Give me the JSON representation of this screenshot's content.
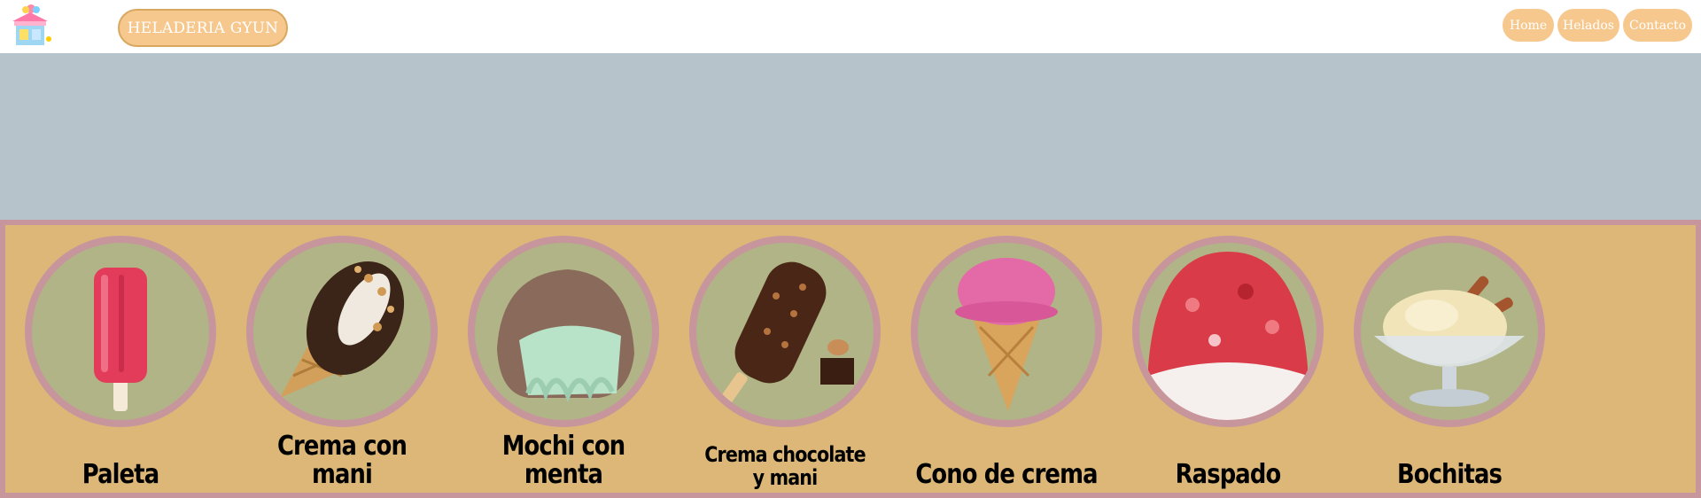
{
  "header": {
    "brand": "HELADERIA GYUN",
    "nav": [
      {
        "label": "Home"
      },
      {
        "label": "Helados"
      },
      {
        "label": "Contacto"
      }
    ]
  },
  "colors": {
    "pill": "#f6c88e",
    "hero": "#b6c3ca",
    "gallery_bg": "#dcb778",
    "gallery_border": "#c7969c",
    "circle_bg": "#b0b486"
  },
  "products": [
    {
      "name": "Paleta",
      "icon": "popsicle-icon"
    },
    {
      "name": "Crema con mani",
      "icon": "peanut-cone-icon"
    },
    {
      "name": "Mochi con menta",
      "icon": "mochi-icon"
    },
    {
      "name": "Crema chocolate\ny mani",
      "icon": "chocolate-bar-icon"
    },
    {
      "name": "Cono de crema",
      "icon": "ice-cream-cone-icon"
    },
    {
      "name": "Raspado",
      "icon": "shaved-ice-icon"
    },
    {
      "name": "Bochitas",
      "icon": "ice-cream-bowl-icon"
    }
  ]
}
